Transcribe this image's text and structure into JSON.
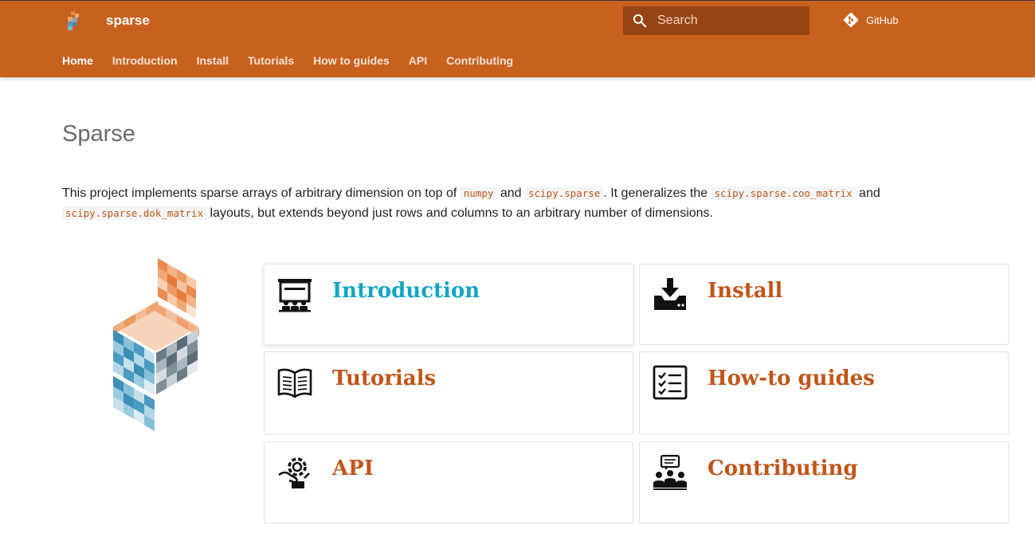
{
  "header": {
    "site_title": "sparse",
    "search": {
      "placeholder": "Search",
      "value": ""
    },
    "repo_label": "GitHub",
    "nav": [
      {
        "label": "Home",
        "active": true
      },
      {
        "label": "Introduction"
      },
      {
        "label": "Install"
      },
      {
        "label": "Tutorials"
      },
      {
        "label": "How to guides"
      },
      {
        "label": "API"
      },
      {
        "label": "Contributing"
      }
    ]
  },
  "main": {
    "title": "Sparse",
    "intro": {
      "t1": "This project implements sparse arrays of arbitrary dimension on top of ",
      "c1": "numpy",
      "t2": " and ",
      "c2": "scipy.sparse",
      "t3": ". It generalizes the ",
      "c3": "scipy.sparse.coo_matrix",
      "t4": " and ",
      "c4": "scipy.sparse.dok_matrix",
      "t5": " layouts, but extends beyond just rows and columns to an arbitrary number of dimensions."
    },
    "cards": [
      {
        "title": "Introduction",
        "icon": "presentation-icon"
      },
      {
        "title": "Install",
        "icon": "download-tray-icon"
      },
      {
        "title": "Tutorials",
        "icon": "open-book-icon"
      },
      {
        "title": "How-to guides",
        "icon": "checklist-icon"
      },
      {
        "title": "API",
        "icon": "gear-hand-icon"
      },
      {
        "title": "Contributing",
        "icon": "community-chat-icon"
      }
    ]
  },
  "colors": {
    "header_bg": "#c8611d",
    "accent": "#c0561a",
    "link_hover": "#12a6c1"
  }
}
